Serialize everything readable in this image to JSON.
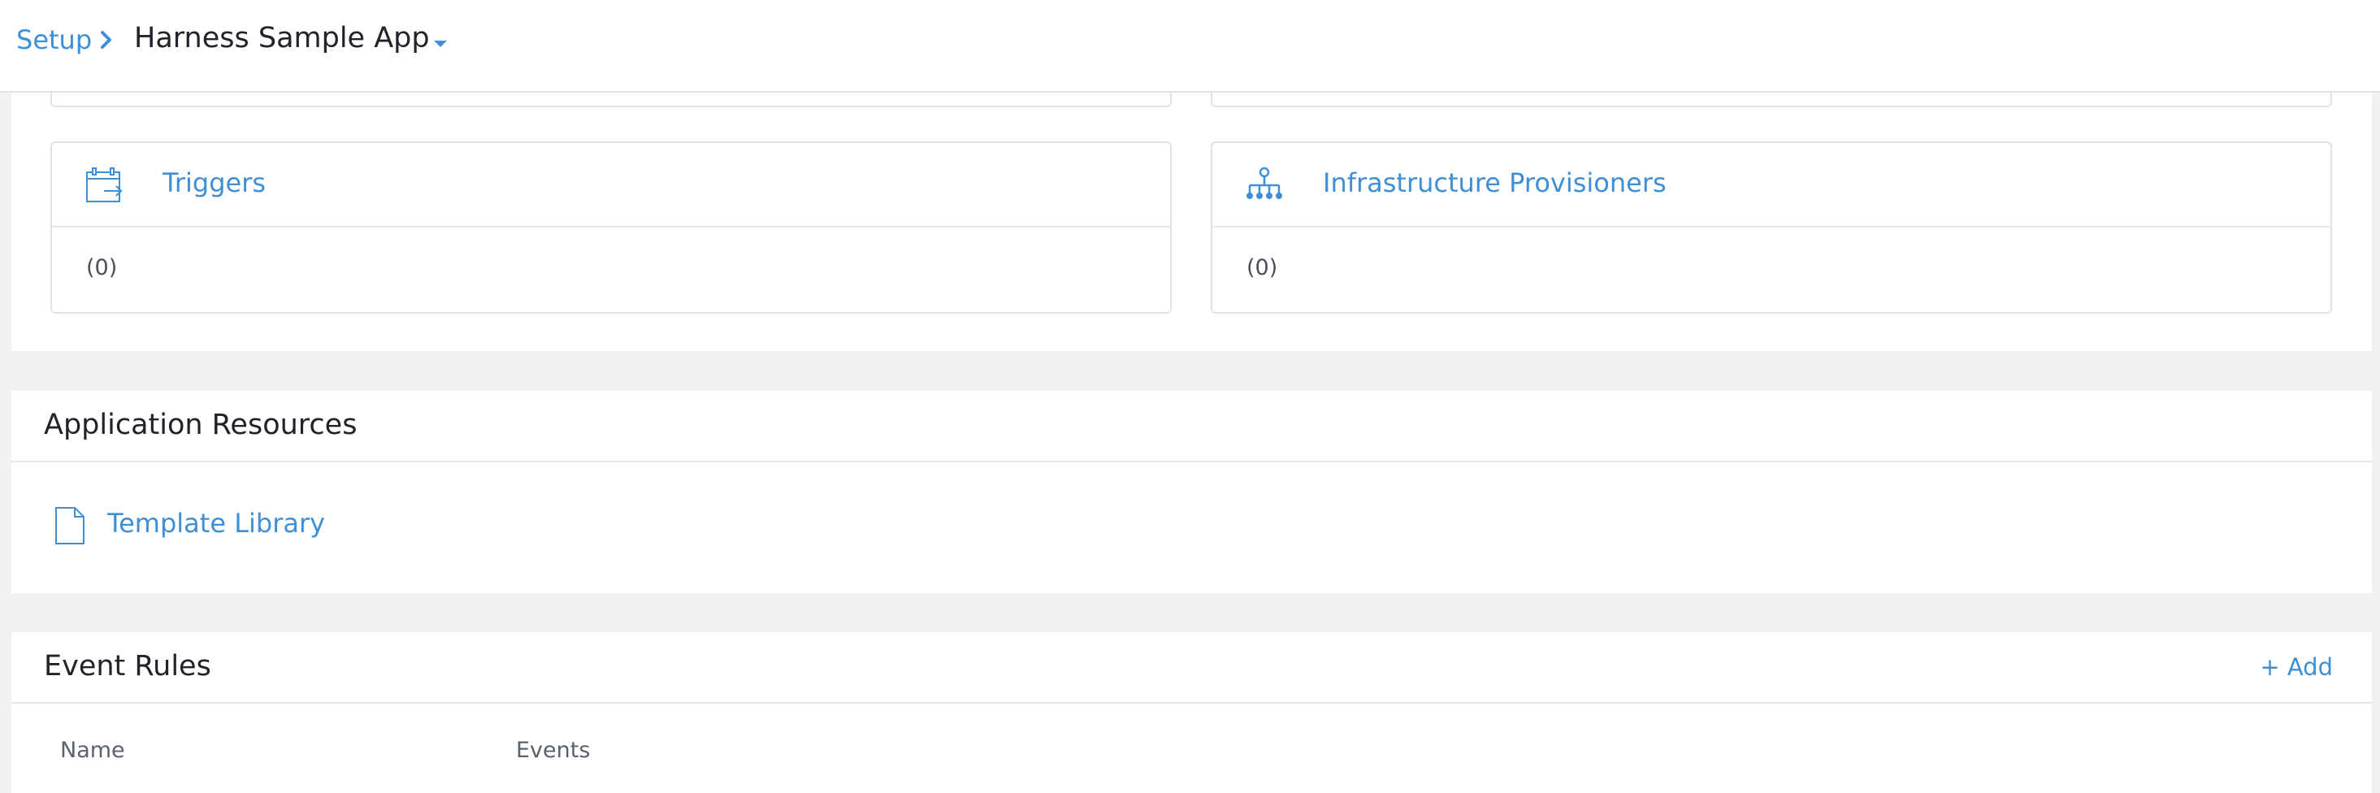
{
  "header": {
    "breadcrumb_root": "Setup",
    "app_name": "Harness Sample App",
    "icons": {
      "separator": "chevron-right-icon",
      "dropdown": "caret-down-icon"
    }
  },
  "cards": [
    {
      "title": "Triggers",
      "count": "(0)",
      "icon": "calendar-arrow-icon"
    },
    {
      "title": "Infrastructure Provisioners",
      "count": "(0)",
      "icon": "hierarchy-icon"
    }
  ],
  "application_resources": {
    "title": "Application Resources",
    "items": [
      {
        "label": "Template Library",
        "icon": "document-icon"
      }
    ]
  },
  "event_rules": {
    "title": "Event Rules",
    "add_label": "+ Add",
    "columns": [
      "Name",
      "Events"
    ]
  },
  "colors": {
    "accent": "#3f8fd6",
    "background": "#f0f1f3",
    "panel": "#ffffff",
    "border": "#dfe2e6",
    "text": "#22222a",
    "muted_text": "#5a6270"
  }
}
